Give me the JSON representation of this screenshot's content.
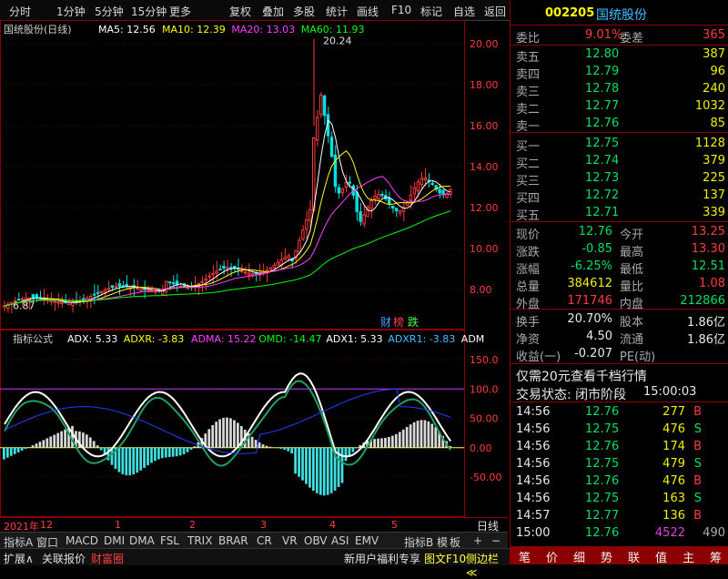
{
  "toolbar": {
    "items": [
      "分时",
      "1分钟",
      "5分钟",
      "15分钟",
      "更多",
      "复权",
      "叠加",
      "多股",
      "统计",
      "画线",
      "F10",
      "标记",
      "自选",
      "返回"
    ]
  },
  "main_chart": {
    "stock_label": "国统股份(日线)",
    "ma": [
      {
        "label": "MA5: 12.56",
        "color": "#ffffff"
      },
      {
        "label": "MA10: 12.39",
        "color": "#ffff00"
      },
      {
        "label": "MA20: 13.03",
        "color": "#ff40ff"
      },
      {
        "label": "MA60: 11.93",
        "color": "#00ff00"
      }
    ],
    "high_label": "20.24",
    "low_label": "6.87",
    "y_ticks": [
      "20.00",
      "18.00",
      "16.00",
      "14.00",
      "12.00",
      "10.00",
      "8.00"
    ],
    "badge": {
      "a": "财",
      "b": "榜",
      "c": "跌"
    }
  },
  "indicator": {
    "name": "指标公式",
    "values": [
      {
        "label": "ADX: 5.33",
        "color": "#ffffff"
      },
      {
        "label": "ADXR: -3.83",
        "color": "#ffff00"
      },
      {
        "label": "ADMA: 15.22",
        "color": "#ff40ff"
      },
      {
        "label": "OMD: -14.47",
        "color": "#00ff00"
      },
      {
        "label": "ADX1: 5.33",
        "color": "#ffffff"
      },
      {
        "label": "ADXR1: -3.83",
        "color": "#40c0ff"
      },
      {
        "label": "ADM",
        "color": "#ffffff"
      }
    ],
    "y_ticks": [
      "150.0",
      "100.0",
      "50.00",
      "0.00",
      "-50.00"
    ]
  },
  "time_axis": {
    "items": [
      "2021年",
      "12",
      "1",
      "2",
      "3",
      "4",
      "5"
    ],
    "right_label": "日线"
  },
  "tabs": [
    "指标A",
    "窗口",
    "MACD",
    "DMI",
    "DMA",
    "FSL",
    "TRIX",
    "BRAR",
    "CR",
    "VR",
    "OBV",
    "ASI",
    "EMV",
    "指标B",
    "模",
    "板",
    "+",
    "−"
  ],
  "statusbar": {
    "expand": "扩展∧",
    "report": "关联报价",
    "wealth": "财富圈",
    "promo": "新用户福利专享",
    "f10": "图文F10",
    "sidebar": "侧边栏≪"
  },
  "quote": {
    "code": "002205",
    "name": "国统股份",
    "weibi_label": "委比",
    "weibi_value": "9.01%",
    "weicha_label": "委差",
    "weicha_value": "365",
    "asks": [
      {
        "label": "卖五",
        "price": "12.80",
        "vol": "387"
      },
      {
        "label": "卖四",
        "price": "12.79",
        "vol": "96"
      },
      {
        "label": "卖三",
        "price": "12.78",
        "vol": "240"
      },
      {
        "label": "卖二",
        "price": "12.77",
        "vol": "1032"
      },
      {
        "label": "卖一",
        "price": "12.76",
        "vol": "85"
      }
    ],
    "bids": [
      {
        "label": "买一",
        "price": "12.75",
        "vol": "1128"
      },
      {
        "label": "买二",
        "price": "12.74",
        "vol": "379"
      },
      {
        "label": "买三",
        "price": "12.73",
        "vol": "225"
      },
      {
        "label": "买四",
        "price": "12.72",
        "vol": "137"
      },
      {
        "label": "买五",
        "price": "12.71",
        "vol": "339"
      }
    ],
    "stats": [
      {
        "l1": "现价",
        "v1": "12.76",
        "c1": "green",
        "l2": "今开",
        "v2": "13.25",
        "c2": "red"
      },
      {
        "l1": "涨跌",
        "v1": "-0.85",
        "c1": "green",
        "l2": "最高",
        "v2": "13.30",
        "c2": "red"
      },
      {
        "l1": "涨幅",
        "v1": "-6.25%",
        "c1": "green",
        "l2": "最低",
        "v2": "12.51",
        "c2": "green"
      },
      {
        "l1": "总量",
        "v1": "384612",
        "c1": "yellow",
        "l2": "量比",
        "v2": "1.08",
        "c2": "red"
      },
      {
        "l1": "外盘",
        "v1": "171746",
        "c1": "red",
        "l2": "内盘",
        "v2": "212866",
        "c2": "green"
      }
    ],
    "stats2": [
      {
        "l1": "换手",
        "v1": "20.70%",
        "l2": "股本",
        "v2": "1.86亿"
      },
      {
        "l1": "净资",
        "v1": "4.50",
        "l2": "流通",
        "v2": "1.86亿"
      },
      {
        "l1": "收益(一)",
        "v1": "-0.207",
        "l2": "PE(动)",
        "v2": ""
      }
    ],
    "promo": "仅需20元查看千档行情",
    "trade_status": "交易状态: 闭市阶段",
    "trade_time": "15:00:03",
    "ticks": [
      {
        "t": "14:56",
        "p": "12.76",
        "v": "277",
        "s": "B"
      },
      {
        "t": "14:56",
        "p": "12.75",
        "v": "476",
        "s": "S"
      },
      {
        "t": "14:56",
        "p": "12.76",
        "v": "174",
        "s": "B"
      },
      {
        "t": "14:56",
        "p": "12.75",
        "v": "479",
        "s": "S"
      },
      {
        "t": "14:56",
        "p": "12.76",
        "v": "476",
        "s": "B"
      },
      {
        "t": "14:56",
        "p": "12.75",
        "v": "163",
        "s": "S"
      },
      {
        "t": "14:57",
        "p": "12.77",
        "v": "136",
        "s": "B"
      },
      {
        "t": "15:00",
        "p": "12.76",
        "v": "4522",
        "s": "490"
      }
    ],
    "right_tabs": [
      "笔",
      "价",
      "细",
      "势",
      "联",
      "值",
      "主",
      "筹"
    ]
  }
}
